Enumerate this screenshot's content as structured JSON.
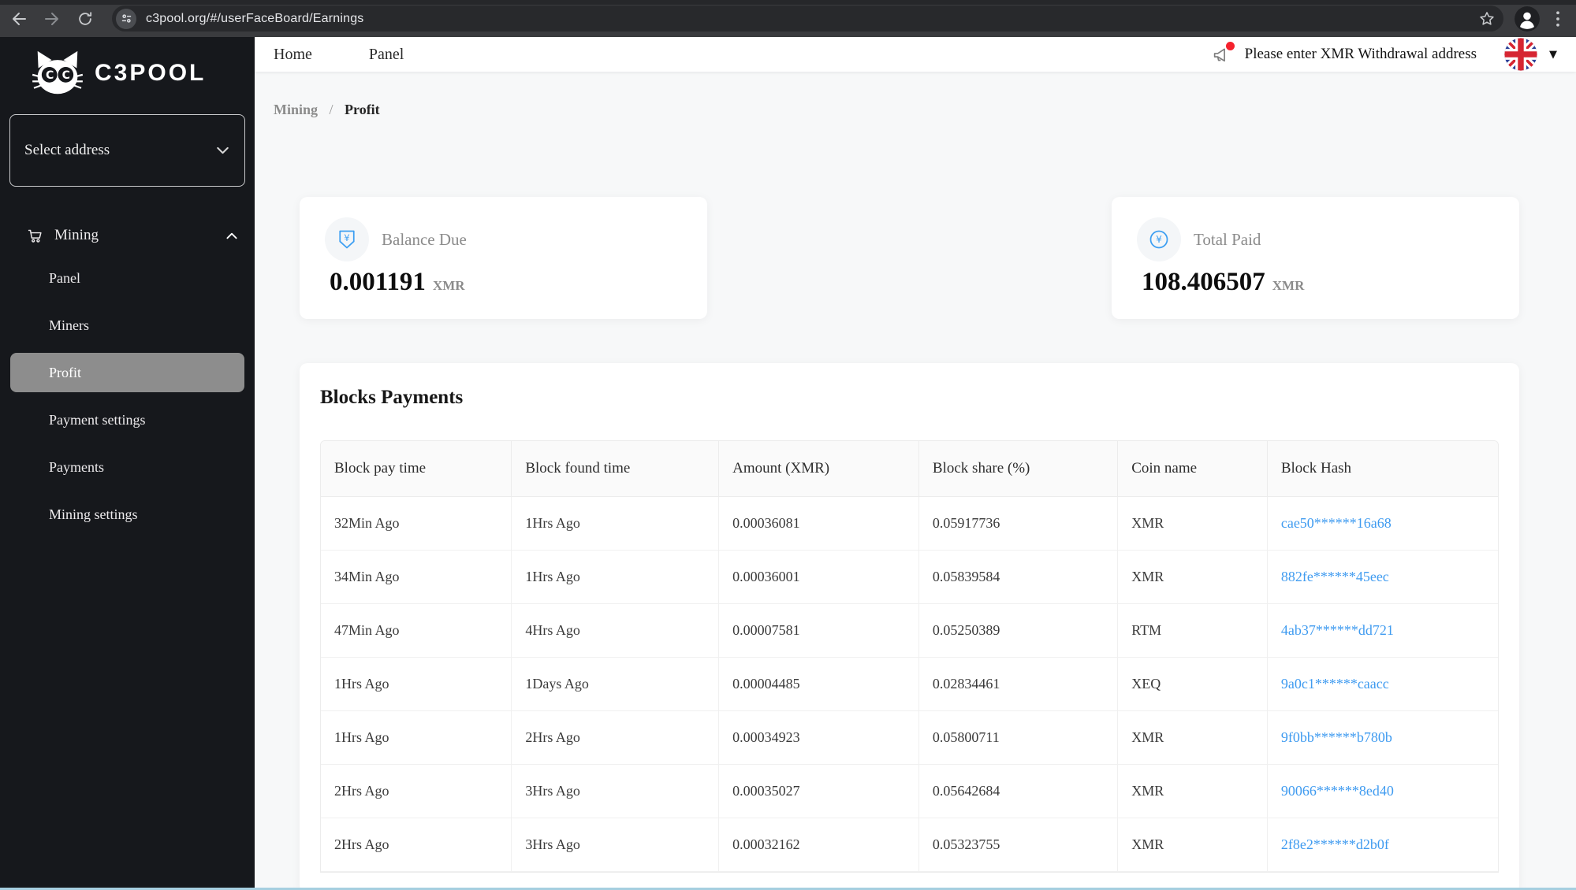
{
  "browser": {
    "url": "c3pool.org/#/userFaceBoard/Earnings"
  },
  "sidebar": {
    "logo_text": "C3POOL",
    "address_select": {
      "placeholder": "Select address"
    },
    "menu": {
      "group_label": "Mining",
      "items": [
        {
          "label": "Panel",
          "selected": false
        },
        {
          "label": "Miners",
          "selected": false
        },
        {
          "label": "Profit",
          "selected": true
        },
        {
          "label": "Payment settings",
          "selected": false
        },
        {
          "label": "Payments",
          "selected": false
        },
        {
          "label": "Mining settings",
          "selected": false
        }
      ]
    }
  },
  "header": {
    "nav": [
      {
        "label": "Home"
      },
      {
        "label": "Panel"
      }
    ],
    "notice": "Please enter XMR Withdrawal address",
    "language_flag": "uk-flag"
  },
  "breadcrumb": {
    "items": [
      "Mining",
      "Profit"
    ],
    "separator": "/"
  },
  "cards": {
    "balance_due": {
      "label": "Balance Due",
      "value": "0.001191",
      "unit": "XMR"
    },
    "total_paid": {
      "label": "Total Paid",
      "value": "108.406507",
      "unit": "XMR"
    }
  },
  "blocks_payments": {
    "title": "Blocks Payments",
    "columns": [
      "Block pay time",
      "Block found time",
      "Amount (XMR)",
      "Block share (%)",
      "Coin name",
      "Block Hash"
    ],
    "rows": [
      [
        "32Min Ago",
        "1Hrs Ago",
        "0.00036081",
        "0.05917736",
        "XMR",
        "cae50******16a68"
      ],
      [
        "34Min Ago",
        "1Hrs Ago",
        "0.00036001",
        "0.05839584",
        "XMR",
        "882fe******45eec"
      ],
      [
        "47Min Ago",
        "4Hrs Ago",
        "0.00007581",
        "0.05250389",
        "RTM",
        "4ab37******dd721"
      ],
      [
        "1Hrs Ago",
        "1Days Ago",
        "0.00004485",
        "0.02834461",
        "XEQ",
        "9a0c1******caacc"
      ],
      [
        "1Hrs Ago",
        "2Hrs Ago",
        "0.00034923",
        "0.05800711",
        "XMR",
        "9f0bb******b780b"
      ],
      [
        "2Hrs Ago",
        "3Hrs Ago",
        "0.00035027",
        "0.05642684",
        "XMR",
        "90066******8ed40"
      ],
      [
        "2Hrs Ago",
        "3Hrs Ago",
        "0.00032162",
        "0.05323755",
        "XMR",
        "2f8e2******d2b0f"
      ]
    ]
  },
  "colors": {
    "accent_blue": "#3d9ff2",
    "link_blue": "#3f9bf0",
    "selected_gray": "#8d8d8d",
    "sidebar_bg": "#16181c"
  }
}
